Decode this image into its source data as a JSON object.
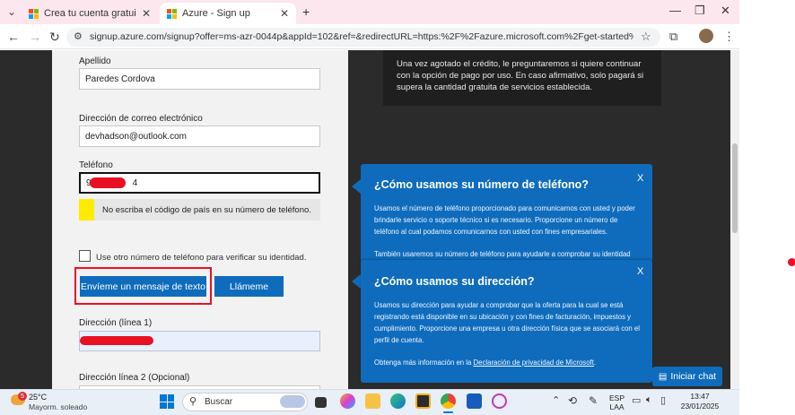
{
  "browser": {
    "tabs": [
      {
        "title": "Crea tu cuenta gratuita de Azu",
        "active": false
      },
      {
        "title": "Azure - Sign up",
        "active": true
      }
    ],
    "new_tab": "+",
    "url": "signup.azure.com/signup?offer=ms-azr-0044p&appId=102&ref=&redirectURL=https:%2F%2Fazure.microsoft.com%2Fget-started%2Fwelcome-to-azu..."
  },
  "form": {
    "apellido_label": "Apellido",
    "apellido_value": "Paredes Cordova",
    "email_label": "Dirección de correo electrónico",
    "email_value": "devhadson@outlook.com",
    "telefono_label": "Teléfono",
    "telefono_value_start": "9",
    "telefono_value_end": "4",
    "warning": "No escriba el código de país en su número de teléfono.",
    "other_phone_label": "Use otro número de teléfono para verificar su identidad.",
    "text_button": "Envíeme un mensaje de texto",
    "call_button": "Llámeme",
    "address1_label": "Dirección (línea 1)",
    "address2_label": "Dirección línea 2 (Opcional)"
  },
  "info_panel": {
    "text": "Una vez agotado el crédito, le preguntaremos si quiere continuar con la opción de pago por uso. En caso afirmativo, solo pagará si supera la cantidad gratuita de servicios establecida."
  },
  "tooltip_phone": {
    "title": "¿Cómo usamos su número de teléfono?",
    "close": "X",
    "body": "Usamos el número de teléfono proporcionado para comunicarnos con usted y poder brindarle servicio o soporte técnico si es necesario. Proporcione un número de teléfono al cual podamos comunicarnos con usted con fines empresariales.",
    "body2": "También usaremos su número de teléfono para ayudarle a comprobar su identidad"
  },
  "tooltip_address": {
    "title": "¿Cómo usamos su dirección?",
    "close": "X",
    "body": "Usamos su dirección para ayudar a comprobar que la oferta para la cual se está registrando está disponible en su ubicación y con fines de facturación, impuestos y cumplimiento. Proporcione una empresa u otra dirección física que se asociará con el perfil de cuenta.",
    "privacy_prefix": "Obtenga más información en la",
    "privacy_link": "Declaración de privacidad de Microsoft",
    "privacy_suffix": "."
  },
  "chat": {
    "label": "Iniciar chat"
  },
  "taskbar": {
    "weather_temp": "25°C",
    "weather_desc": "Mayorm. soleado",
    "weather_badge": "5",
    "search": "Buscar",
    "lang_top": "ESP",
    "lang_bottom": "LAA",
    "time": "13:47",
    "date": "23/01/2025"
  },
  "colors": {
    "accent": "#0f6cbd",
    "highlight": "#e81123",
    "warning": "#ffeb00"
  }
}
